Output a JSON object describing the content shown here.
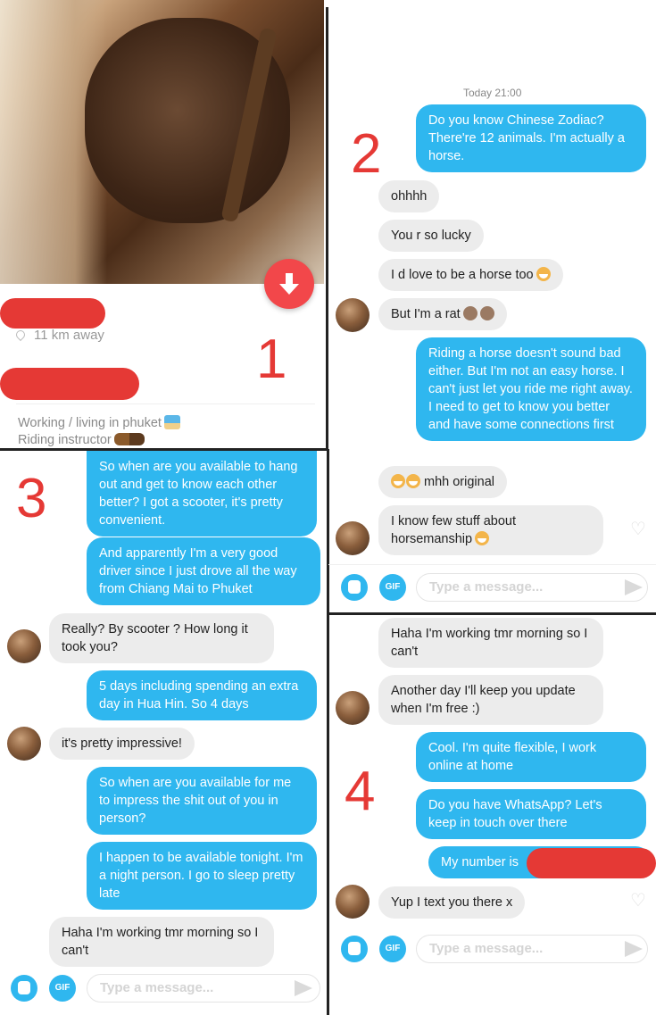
{
  "colors": {
    "accent": "#2fb7ef",
    "redact": "#e53935",
    "incoming": "#ececec"
  },
  "panel1": {
    "number": "1",
    "distance": "11 km away",
    "bio_line1": "Working / living in phuket",
    "bio_line2": "Riding instructor",
    "fab_icon": "arrow-down-icon"
  },
  "panel2": {
    "number": "2",
    "timestamp": "Today 21:00",
    "messages": [
      {
        "side": "out",
        "text": "Do you know  Chinese Zodiac? There're 12 animals. I'm actually a horse."
      },
      {
        "side": "in",
        "text": "ohhhh"
      },
      {
        "side": "in",
        "text": "You r so lucky"
      },
      {
        "side": "in",
        "text": "I d love to be a horse too"
      },
      {
        "side": "in",
        "text": "But I'm a rat"
      },
      {
        "side": "out",
        "text": "Riding a horse doesn't sound bad either. But I'm not an easy horse. I can't just let you ride me right away. I need to get to know you better and have some connections first"
      },
      {
        "side": "in",
        "text": "mhh original"
      },
      {
        "side": "in",
        "text": "I know few stuff about horsemanship"
      }
    ],
    "placeholder": "Type a message...",
    "gif_label": "GIF"
  },
  "panel3": {
    "number": "3",
    "messages": [
      {
        "side": "out",
        "text": "So when are you available to hang out and get to know each other better? I got a scooter, it's pretty convenient."
      },
      {
        "side": "out",
        "text": "And apparently I'm a very good driver since I just drove all the way from Chiang Mai to Phuket"
      },
      {
        "side": "in",
        "text": "Really? By scooter ? How long it took you?"
      },
      {
        "side": "out",
        "text": "5 days including spending an extra day in Hua Hin. So 4 days"
      },
      {
        "side": "in",
        "text": "it's pretty impressive!"
      },
      {
        "side": "out",
        "text": "So when are you available for me to impress the shit out of you in person?"
      },
      {
        "side": "out",
        "text": "I happen to be available tonight. I'm a night person. I go to sleep pretty late"
      },
      {
        "side": "in",
        "text": "Haha I'm working tmr morning so I can't"
      }
    ],
    "placeholder": "Type a message...",
    "gif_label": "GIF"
  },
  "panel4": {
    "number": "4",
    "messages": [
      {
        "side": "in",
        "text": "Haha I'm working tmr morning so I can't"
      },
      {
        "side": "in",
        "text": "Another day I'll keep you update when I'm free :)"
      },
      {
        "side": "out",
        "text": "Cool. I'm quite flexible, I work online at home"
      },
      {
        "side": "out",
        "text": "Do you have WhatsApp? Let's keep in touch over there"
      },
      {
        "side": "out",
        "text": "My number is"
      },
      {
        "side": "in",
        "text": "Yup I text you there x"
      }
    ],
    "placeholder": "Type a message...",
    "gif_label": "GIF"
  }
}
